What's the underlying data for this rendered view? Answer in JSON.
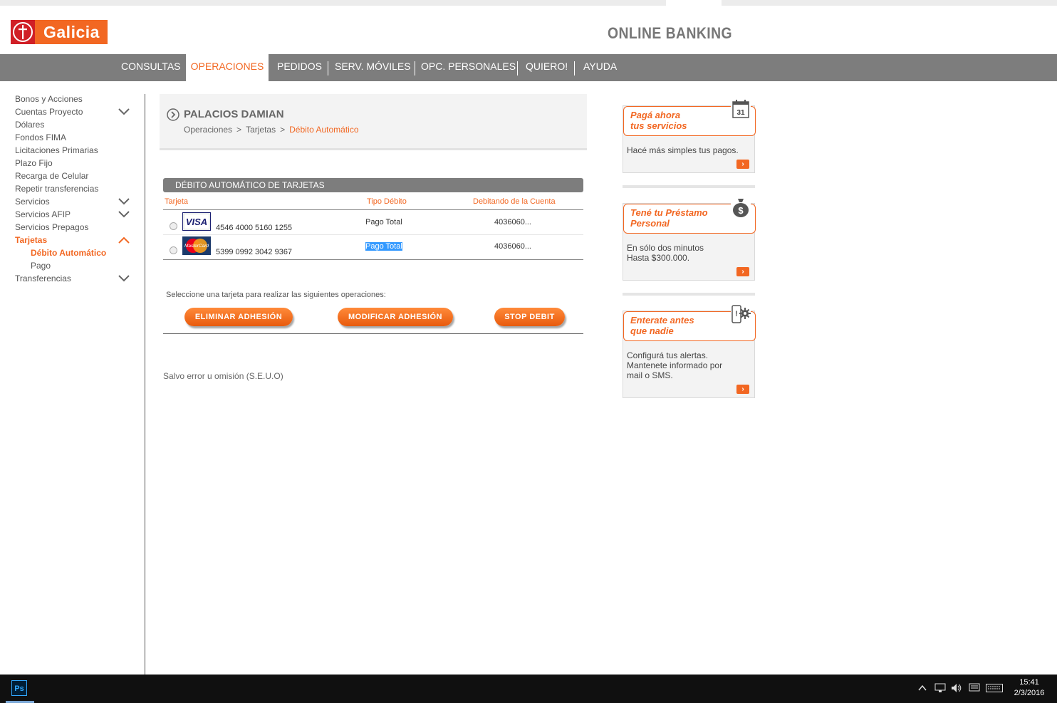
{
  "header": {
    "brand": "Galicia",
    "product": "ONLINE BANKING"
  },
  "nav": {
    "items": [
      "CONSULTAS",
      "OPERACIONES",
      "PEDIDOS",
      "SERV. MÓVILES",
      "OPC. PERSONALES",
      "QUIERO!",
      "AYUDA"
    ],
    "active": "OPERACIONES"
  },
  "sidebar": {
    "items": [
      {
        "label": "Bonos y Acciones"
      },
      {
        "label": "Cuentas Proyecto",
        "expandable": true
      },
      {
        "label": "Dólares"
      },
      {
        "label": "Fondos FIMA"
      },
      {
        "label": "Licitaciones Primarias"
      },
      {
        "label": "Plazo Fijo"
      },
      {
        "label": "Recarga de Celular"
      },
      {
        "label": "Repetir transferencias"
      },
      {
        "label": "Servicios",
        "expandable": true
      },
      {
        "label": "Servicios AFIP",
        "expandable": true
      },
      {
        "label": "Servicios Prepagos"
      },
      {
        "label": "Tarjetas",
        "expanded": true
      },
      {
        "label": "Débito Automático",
        "sub": true,
        "active": true
      },
      {
        "label": "Pago",
        "sub": true
      },
      {
        "label": "Transferencias",
        "expandable": true
      }
    ]
  },
  "page": {
    "user": "PALACIOS DAMIAN",
    "breadcrumb": [
      "Operaciones",
      "Tarjetas",
      "Débito Automático"
    ],
    "section_title": "DÉBITO AUTOMÁTICO DE TARJETAS",
    "columns": [
      "Tarjeta",
      "Tipo Débito",
      "Debitando de la Cuenta"
    ],
    "rows": [
      {
        "brand": "VISA",
        "number": "4546 4000 5160 1255",
        "tipo": "Pago Total",
        "cuenta": "4036060..."
      },
      {
        "brand": "MasterCard",
        "number": "5399 0992 3042 9367",
        "tipo": "Pago Total",
        "cuenta": "4036060..."
      }
    ],
    "instruction": "Seleccione una tarjeta para realizar las siguientes operaciones:",
    "buttons": {
      "eliminar": "ELIMINAR ADHESIÓN",
      "modificar": "MODIFICAR ADHESIÓN",
      "stop": "STOP DEBIT"
    },
    "disclaimer": "Salvo error u omisión (S.E.U.O)"
  },
  "promos": [
    {
      "title1": "Pagá ahora",
      "title2": "tus servicios",
      "text": [
        "Hacé más simples tus pagos."
      ],
      "icon": "calendar-icon",
      "icon_text": "31"
    },
    {
      "title1": "Tené tu Préstamo",
      "title2": "Personal",
      "text": [
        "En sólo dos minutos",
        "Hasta $300.000."
      ],
      "icon": "money-bag-icon",
      "icon_text": "$"
    },
    {
      "title1": "Enterate antes",
      "title2": "que nadie",
      "text": [
        "Configurá tus alertas.",
        "Mantenete informado por",
        "mail o SMS."
      ],
      "icon": "phone-gear-icon"
    }
  ],
  "taskbar": {
    "app": "Ps",
    "time": "15:41",
    "date": "2/3/2016"
  },
  "colors": {
    "accent": "#f26722",
    "nav_bg": "#7d7d7d",
    "logo_red": "#d01f26"
  }
}
